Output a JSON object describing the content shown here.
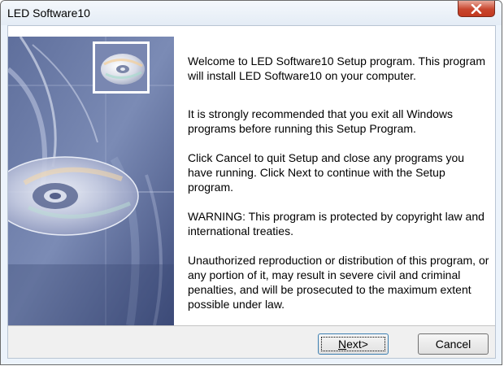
{
  "window": {
    "title": "LED Software10"
  },
  "content": {
    "paragraphs": [
      "Welcome to LED Software10 Setup program. This program will install LED Software10 on your computer.",
      "It is strongly recommended that you exit all Windows programs before running this Setup Program.",
      "Click Cancel to quit Setup and close any programs you have running.  Click Next to continue with the Setup program.",
      "WARNING: This program is protected by copyright law and international treaties.",
      "Unauthorized reproduction or distribution of this program, or any portion of it, may result in severe civil and criminal penalties, and will be prosecuted to the maximum extent possible under law."
    ]
  },
  "buttons": {
    "next_label_first": "N",
    "next_label_rest": "ext>",
    "cancel_label": "Cancel"
  },
  "colors": {
    "close_button": "#c8462e",
    "side_image_base": "#4a5c8c"
  },
  "icons": [
    "close-icon",
    "cd-disc-icon"
  ]
}
